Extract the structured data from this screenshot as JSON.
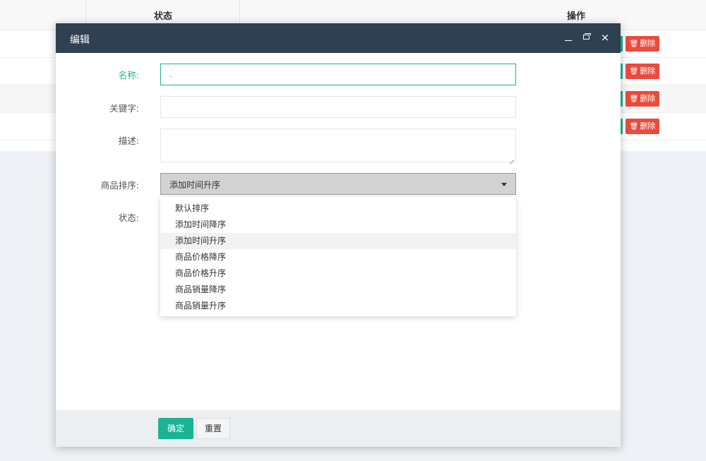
{
  "table": {
    "columns": {
      "status": "状态",
      "actions": "操作"
    },
    "rows": [
      {
        "delete_label": "删除"
      },
      {
        "delete_label": "删除"
      },
      {
        "delete_label": "删除"
      },
      {
        "delete_label": "删除"
      }
    ]
  },
  "modal": {
    "title": "编辑",
    "close_glyph": "×",
    "fields": {
      "name": {
        "label": "名称:",
        "value": "."
      },
      "keyword": {
        "label": "关键字:",
        "value": ""
      },
      "description": {
        "label": "描述:",
        "value": ""
      },
      "sort": {
        "label": "商品排序:",
        "selected": "添加时间升序",
        "options": [
          "默认排序",
          "添加时间降序",
          "添加时间升序",
          "商品价格降序",
          "商品价格升序",
          "商品销量降序",
          "商品销量升序"
        ]
      },
      "status": {
        "label": "状态:"
      }
    },
    "footer": {
      "ok_label": "确定",
      "reset_label": "重置"
    }
  },
  "colors": {
    "primary": "#1ab394",
    "danger": "#e94b3c",
    "header": "#2f4050"
  },
  "icons": {
    "trash": "trash-icon",
    "minimize": "minimize-icon",
    "maximize": "maximize-icon",
    "close": "close-icon",
    "caret": "caret-down-icon"
  }
}
